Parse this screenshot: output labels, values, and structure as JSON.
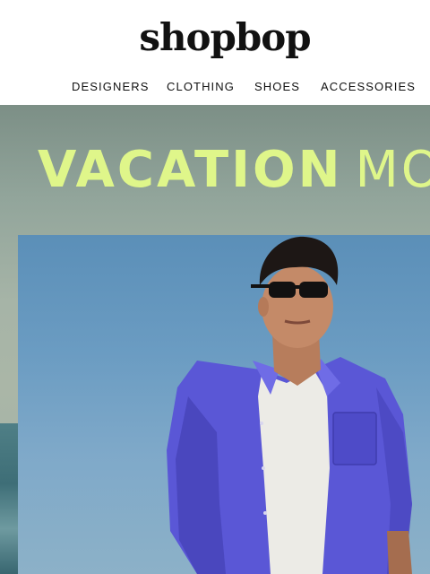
{
  "header": {
    "logo": "shopbop",
    "nav": [
      {
        "label": "DESIGNERS"
      },
      {
        "label": "CLOTHING"
      },
      {
        "label": "SHOES"
      },
      {
        "label": "ACCESSORIES"
      }
    ]
  },
  "hero": {
    "title_bold": "VACATION",
    "title_light": "MO",
    "accent_color": "#dff68a",
    "image": "man-in-purple-linen-shirt-photo"
  }
}
